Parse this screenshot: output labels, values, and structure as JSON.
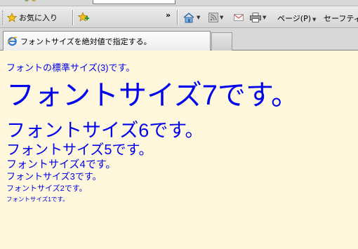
{
  "toolbar": {
    "favorites_label": "お気に入り",
    "overflow_chevron": "»",
    "page_menu_label": "ページ(P)",
    "safety_menu_label": "セーフティ(S"
  },
  "tab": {
    "title": "フォントサイズを絶対値で指定する。"
  },
  "content": {
    "lines": [
      "フォントの標準サイズ(3)です。",
      "フォントサイズ7です。",
      "フォントサイズ6です。",
      "フォントサイズ5です。",
      "フォントサイズ4です。",
      "フォントサイズ3です。",
      "フォントサイズ2です。",
      "フォントサイズ1です。"
    ]
  },
  "colors": {
    "page_background": "#fff8dc",
    "text": "#0000ee"
  }
}
